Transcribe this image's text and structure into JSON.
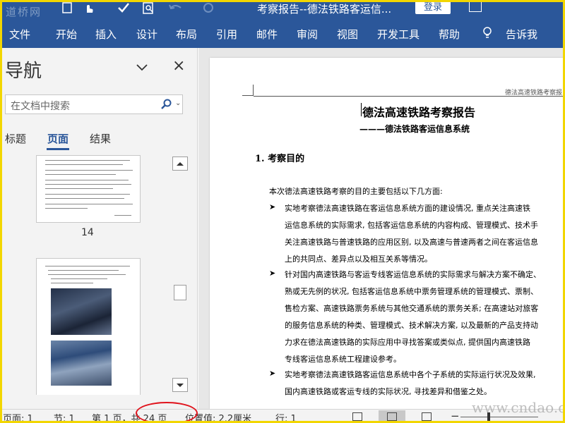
{
  "titlebar": {
    "watermark_logo": "道桥网",
    "title": "考察报告--德法铁路客运信...",
    "login_label": "登录"
  },
  "ribbon": {
    "tabs": [
      "文件",
      "开始",
      "插入",
      "设计",
      "布局",
      "引用",
      "邮件",
      "审阅",
      "视图",
      "开发工具",
      "帮助"
    ],
    "tell_me": "告诉我"
  },
  "nav": {
    "title": "导航",
    "search_placeholder": "在文档中搜索",
    "tabs": [
      "标题",
      "页面",
      "结果"
    ],
    "active_tab": "页面",
    "thumb_page_number": "14"
  },
  "document": {
    "header_text": "德法高速铁路考察报",
    "title": "德法高速铁路考察报告",
    "subtitle": "———德法铁路客运信息系统",
    "section1": "1.  考察目的",
    "intro": "本次德法高速铁路考察的目的主要包括以下几方面:",
    "bullet1": [
      "实地考察德法高速铁路在客运信息系统方面的建设情况, 重点关注高速铁",
      "运信息系统的实际需求, 包括客运信息系统的内容构成、管理模式、技术手",
      "关注高速铁路与普速铁路的应用区别, 以及高速与普速两者之间在客运信息",
      "上的共同点、差异点以及相互关系等情况。"
    ],
    "bullet2": [
      "针对国内高速铁路与客运专线客运信息系统的实际需求与解决方案不确定、",
      "熟或无先例的状况, 包括客运信息系统中票务管理系统的管理模式、票制、",
      "售检方案、高速铁路票务系统与其他交通系统的票务关系; 在高速站对旅客",
      "的服务信息系统的种类、管理模式、技术解决方案, 以及最新的产品支持动",
      "力求在德法高速铁路的实际应用中寻找答案或类似点, 提供国内高速铁路",
      "专线客运信息系统工程建设参考。"
    ],
    "bullet3": [
      "实地考察德法高速铁路客运信息系统中各个子系统的实际运行状况及效果,",
      "国内高速铁路或客运专线的实际状况, 寻找差异和借鉴之处。"
    ]
  },
  "status": {
    "page": "页面: 1",
    "section": "节: 1",
    "page_of": "第 1 页，共 24 页",
    "position": "位置值: 2.2厘米",
    "line": "行: 1",
    "site_watermark": "www.cndao.com"
  }
}
